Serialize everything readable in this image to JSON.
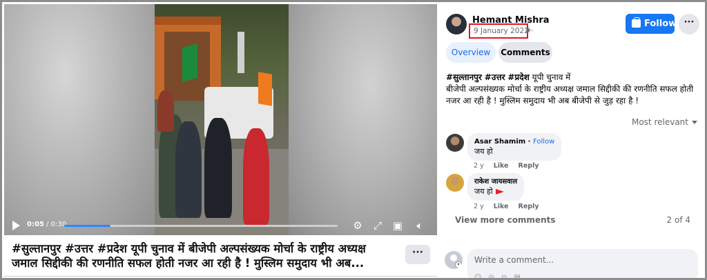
{
  "video": {
    "current_time": "0:05",
    "separator": " / ",
    "duration": "0:30",
    "progress_fraction": 0.17
  },
  "post_caption": {
    "line1": "#सुल्तानपुर #उत्तर #प्रदेश यूपी चुनाव में बीजेपी अल्पसंख्यक मोर्चा के राष्ट्रीय अध्यक्ष",
    "line2": "जमाल सिद्दीकी की रणनीति सफल होती नजर आ रही है ! मुस्लिम समुदाय भी अब...",
    "more_label": "···"
  },
  "author": {
    "name": "Hemant Mishra",
    "date": "9 January 2022 ·",
    "follow_label": "Follow",
    "more_label": "···"
  },
  "tabs": {
    "overview": "Overview",
    "comments": "Comments"
  },
  "post_text": {
    "tag1": "#सुल्तानपुर",
    "tag2": "#उत्तर",
    "tag3": "#प्रदेश",
    "line1_rest": "यूपी चुनाव में",
    "line2": "बीजेपी अल्पसंख्यक मोर्चा के राष्ट्रीय अध्यक्ष जमाल सिद्दीकी की रणनीति सफल होती नजर आ रही है ! मुस्लिम समुदाय भी अब बीजेपी से जुड़ रहा है !"
  },
  "sort_label": "Most relevant",
  "comments": [
    {
      "name": "Asar Shamim",
      "follow": "Follow",
      "text": "जय हो",
      "age": "2 y",
      "like": "Like",
      "reply": "Reply"
    },
    {
      "name": "राकेश जायसवाल",
      "text": "जय हो",
      "age": "2 y",
      "like": "Like",
      "reply": "Reply"
    }
  ],
  "view_more": "View more comments",
  "count": "2 of 4",
  "composer": {
    "placeholder": "Write a comment..."
  },
  "colors": {
    "accent": "#1877f2",
    "highlight_box": "#e8141a"
  }
}
